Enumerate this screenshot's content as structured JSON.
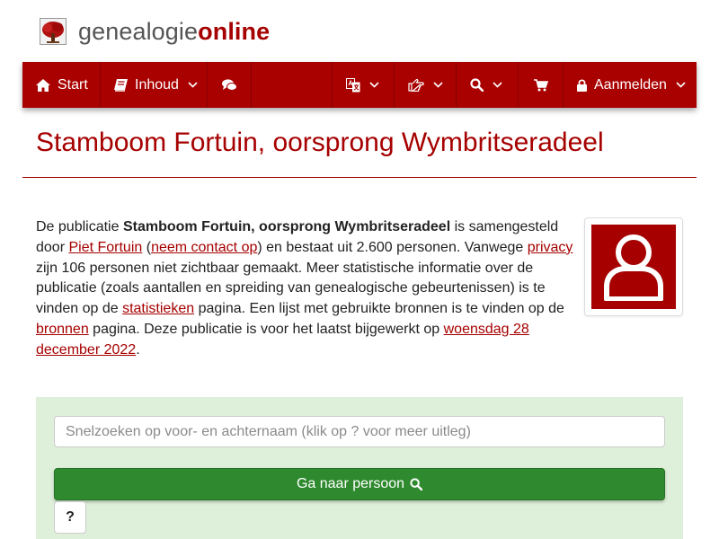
{
  "brand": {
    "name_plain": "genealogie",
    "name_accent": "online",
    "logo_icon": "tree-icon"
  },
  "nav": {
    "start_label": "Start",
    "contents_label": "Inhoud",
    "login_label": "Aanmelden",
    "icons": {
      "start": "home-icon",
      "contents": "book-icon",
      "chat": "comments-icon",
      "language": "translate-icon",
      "share": "hand-pointer-icon",
      "search": "search-icon",
      "cart": "shopping-cart-icon",
      "login": "lock-icon"
    }
  },
  "page_title": "Stamboom Fortuin, oorsprong Wymbritseradeel",
  "intro": {
    "t1": "De publicatie ",
    "pub_name": "Stamboom Fortuin, oorsprong Wymbritseradeel",
    "t2": " is samengesteld door ",
    "author_link": "Piet Fortuin",
    "t3": " (",
    "contact_link": "neem contact op",
    "t4": ") en bestaat uit 2.600 personen. Vanwege ",
    "privacy_link": "privacy",
    "t5": " zijn 106 personen niet zichtbaar gemaakt. Meer statistische informatie over de publicatie (zoals aantallen en spreiding van genealogische gebeurtenissen) is te vinden op de ",
    "stats_link": "statistieken",
    "t6": " pagina. Een lijst met gebruikte bronnen is te vinden op de ",
    "sources_link": "bronnen",
    "t7": " pagina. Deze publicatie is voor het laatst bijgewerkt op ",
    "date_link": "woensdag 28 december 2022",
    "t8": "."
  },
  "avatar_icon": "user-icon",
  "search": {
    "placeholder": "Snelzoeken op voor- en achternaam (klik op ? voor meer uitleg)",
    "go_label": "Ga naar persoon",
    "help_label": "?"
  },
  "colors": {
    "brand_red": "#a90000",
    "title_red": "#a60000",
    "panel_green": "#deefda",
    "button_green": "#2f8a2f"
  }
}
